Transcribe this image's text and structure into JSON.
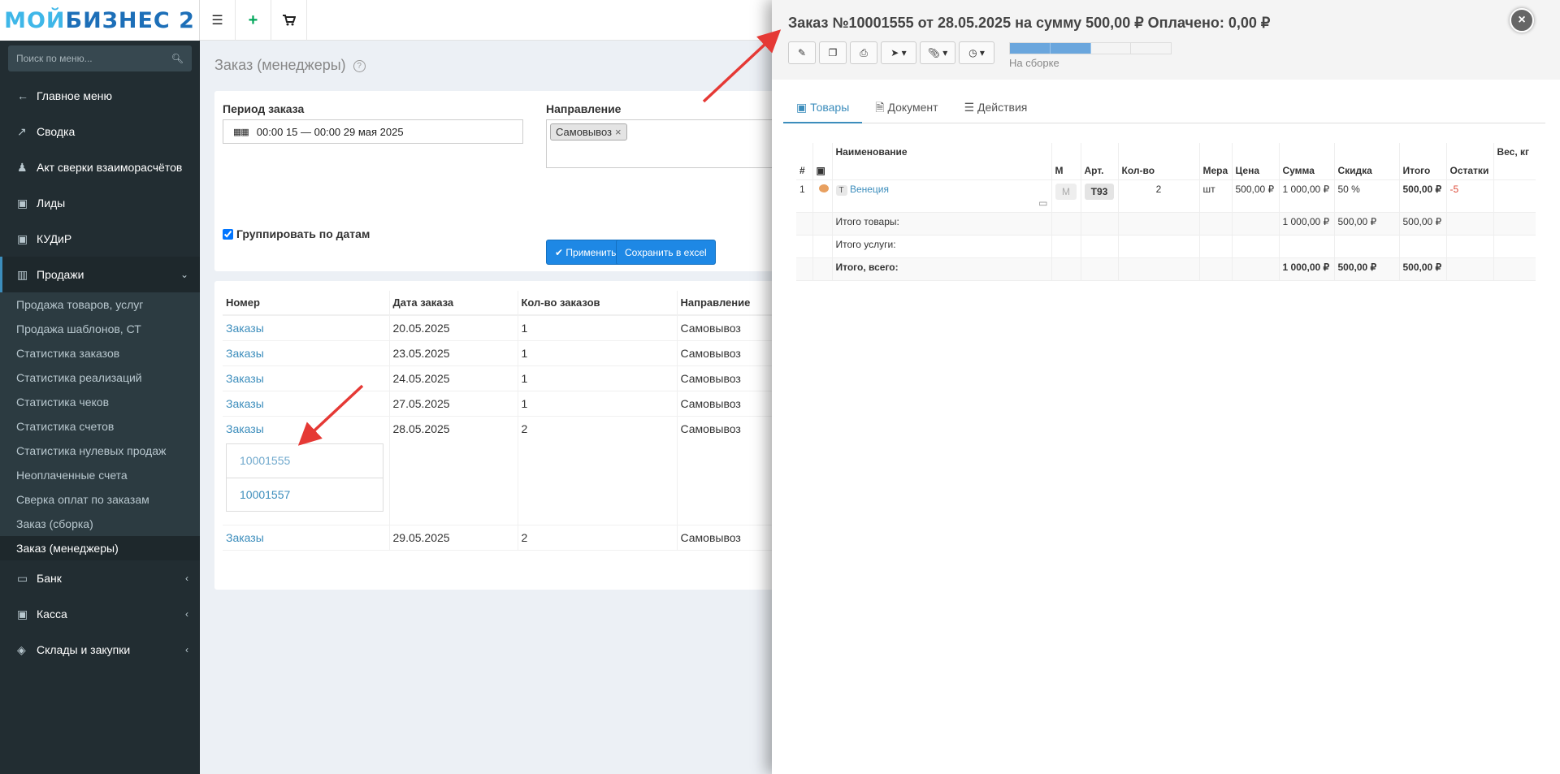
{
  "logo": {
    "part1": "МОЙ",
    "part2": "БИЗНЕС 2"
  },
  "sidebar": {
    "search_placeholder": "Поиск по меню...",
    "items": [
      {
        "label": "Главное меню",
        "icon": "←"
      },
      {
        "label": "Сводка",
        "icon": "↗"
      },
      {
        "label": "Акт сверки взаиморасчётов",
        "icon": "👥"
      },
      {
        "label": "Лиды",
        "icon": "▣"
      },
      {
        "label": "КУДиР",
        "icon": "▣"
      },
      {
        "label": "Продажи",
        "icon": "▥"
      }
    ],
    "sales_sub": [
      "Продажа товаров, услуг",
      "Продажа шаблонов, СТ",
      "Статистика заказов",
      "Статистика реализаций",
      "Статистика чеков",
      "Статистика счетов",
      "Статистика нулевых продаж",
      "Неоплаченные счета",
      "Сверка оплат по заказам",
      "Заказ (сборка)",
      "Заказ (менеджеры)"
    ],
    "bottom_items": [
      {
        "label": "Банк",
        "icon": "▭"
      },
      {
        "label": "Касса",
        "icon": "▣"
      },
      {
        "label": "Склады и закупки",
        "icon": "◈"
      }
    ]
  },
  "page": {
    "title": "Заказ (менеджеры)",
    "period_label": "Период заказа",
    "period_value": "00:00 15 — 00:00 29 мая 2025",
    "direction_label": "Направление",
    "direction_tag": "Самовывоз",
    "group_label": "Группировать по датам",
    "apply_label": "✔ Применить",
    "excel_label": "Сохранить в excel"
  },
  "orders_table": {
    "headers": [
      "Номер",
      "Дата заказа",
      "Кол-во заказов",
      "Направление"
    ],
    "rows": [
      {
        "number": "Заказы",
        "date": "20.05.2025",
        "count": "1",
        "direction": "Самовывоз"
      },
      {
        "number": "Заказы",
        "date": "23.05.2025",
        "count": "1",
        "direction": "Самовывоз"
      },
      {
        "number": "Заказы",
        "date": "24.05.2025",
        "count": "1",
        "direction": "Самовывоз"
      },
      {
        "number": "Заказы",
        "date": "27.05.2025",
        "count": "1",
        "direction": "Самовывоз"
      },
      {
        "number": "Заказы",
        "date": "28.05.2025",
        "count": "2",
        "direction": "Самовывоз"
      },
      {
        "number": "Заказы",
        "date": "29.05.2025",
        "count": "2",
        "direction": "Самовывоз"
      }
    ],
    "expanded_orders": [
      "10001555",
      "10001557"
    ]
  },
  "panel": {
    "title": "Заказ №10001555 от 28.05.2025 на сумму 500,00 ₽ Оплачено: 0,00 ₽",
    "status": "На сборке",
    "progress_percent": 50,
    "close_label": "×",
    "tabs": [
      "Товары",
      "Документ",
      "Действия"
    ],
    "items_headers": {
      "num": "#",
      "name": "Наименование",
      "m": "М",
      "art": "Арт.",
      "qty": "Кол-во",
      "unit": "Мера",
      "price": "Цена",
      "sum": "Сумма",
      "discount": "Скидка",
      "total": "Итого",
      "stock": "Остатки",
      "weight": "Вес, кг"
    },
    "item": {
      "num": "1",
      "type": "Т",
      "name": "Венеция",
      "m": "М",
      "art": "Т93",
      "qty": "2",
      "unit": "шт",
      "price": "500,00 ₽",
      "sum": "1 000,00 ₽",
      "discount": "50 %",
      "total": "500,00 ₽",
      "stock": "-5"
    },
    "totals": {
      "goods_label": "Итого товары:",
      "goods_sum": "1 000,00 ₽",
      "goods_discount": "500,00 ₽",
      "goods_total": "500,00 ₽",
      "services_label": "Итого услуги:",
      "all_label": "Итого, всего:",
      "all_sum": "1 000,00 ₽",
      "all_discount": "500,00 ₽",
      "all_total": "500,00 ₽"
    }
  },
  "colors": {
    "accent": "#3c8dbc",
    "sidebar": "#222d32",
    "button": "#1e88e5",
    "arrow": "#e53935",
    "negative": "#dd4b39"
  }
}
